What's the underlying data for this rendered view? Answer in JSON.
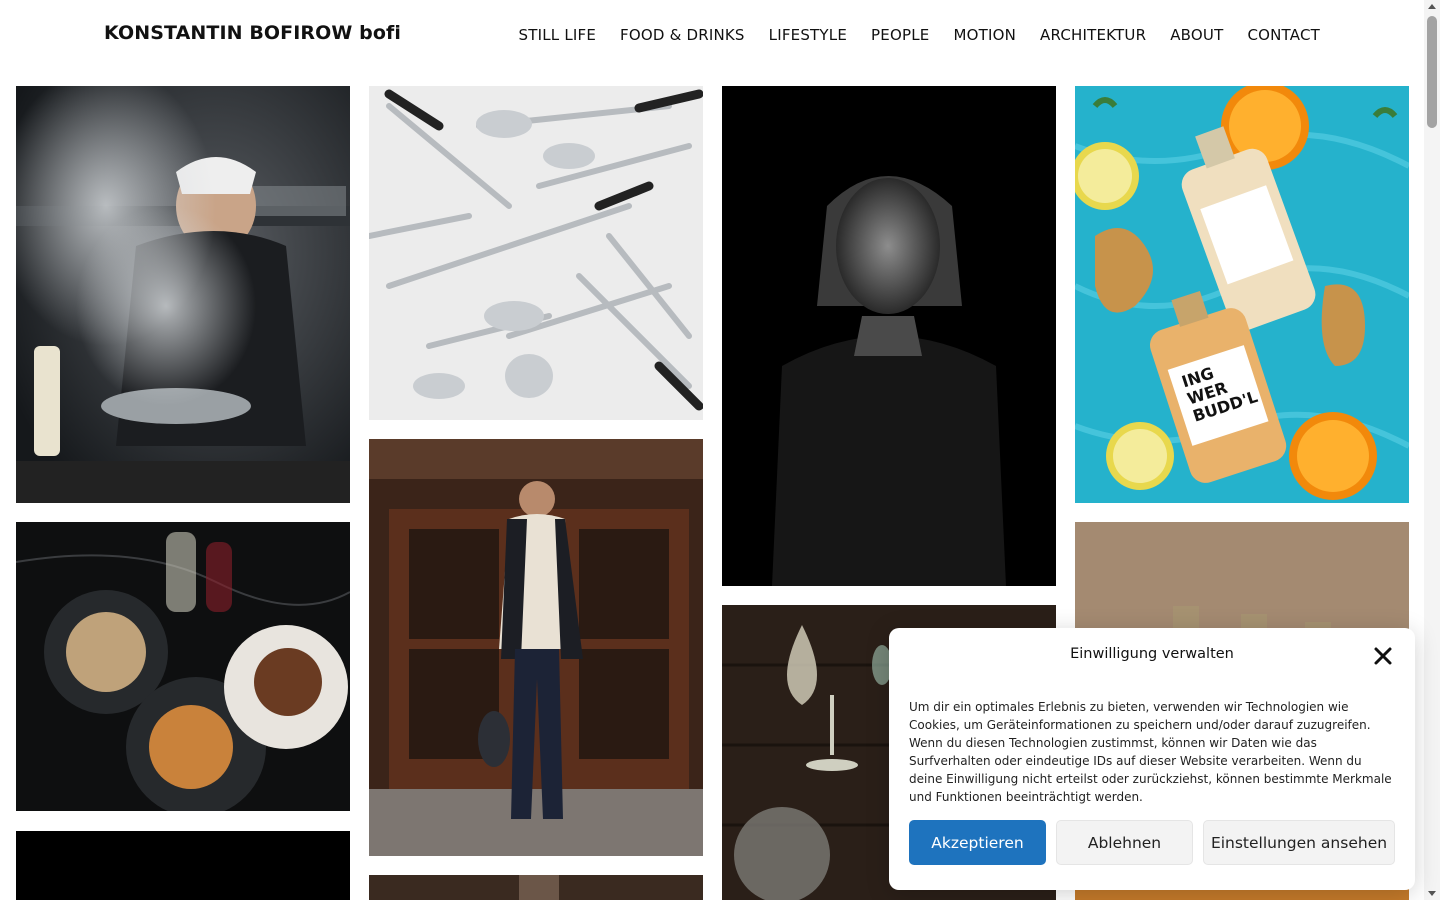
{
  "header": {
    "brand": "KONSTANTIN BOFIROW bofi",
    "nav": [
      "STILL LIFE",
      "FOOD & DRINKS",
      "LIFESTYLE",
      "PEOPLE",
      "MOTION",
      "ARCHITEKTUR",
      "ABOUT",
      "CONTACT"
    ]
  },
  "bottle_label": {
    "line1": "ING",
    "line2": "WER",
    "line3": "BUDD'L"
  },
  "consent": {
    "title": "Einwilligung verwalten",
    "text": "Um dir ein optimales Erlebnis zu bieten, verwenden wir Technologien wie Cookies, um Geräteinformationen zu speichern und/oder darauf zuzugreifen. Wenn du diesen Technologien zustimmst, können wir Daten wie das Surfverhalten oder eindeutige IDs auf dieser Website verarbeiten. Wenn du deine Einwilligung nicht erteilst oder zurückziehst, können bestimmte Merkmale und Funktionen beeinträchtigt werden.",
    "accept": "Akzeptieren",
    "deny": "Ablehnen",
    "settings": "Einstellungen ansehen"
  },
  "colors": {
    "accent": "#1e73be"
  }
}
